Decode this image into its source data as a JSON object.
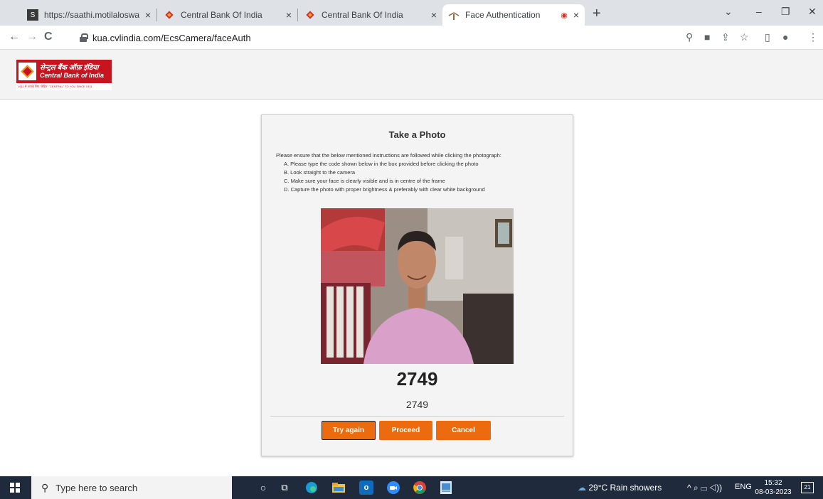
{
  "browser": {
    "tabs": [
      {
        "title": "https://saathi.motilaloswal.com/E",
        "icon": "motilal-icon",
        "active": false
      },
      {
        "title": "Central Bank Of India",
        "icon": "central-bank-icon",
        "active": false
      },
      {
        "title": "Central Bank Of India",
        "icon": "central-bank-icon",
        "active": false
      },
      {
        "title": "Face Authentication",
        "icon": "face-auth-icon",
        "active": true
      }
    ],
    "close_glyph": "×",
    "new_tab_glyph": "+",
    "window_controls": {
      "dropdown": "⌄",
      "minimize": "–",
      "restore": "❐",
      "close": "✕"
    },
    "nav": {
      "back": "←",
      "forward": "→",
      "reload": "C"
    },
    "url": "kua.cvlindia.com/EcsCamera/faceAuth",
    "toolbar_icons": {
      "location": "⚲",
      "camera": "■",
      "share": "⇪",
      "star": "☆",
      "sidepanel": "▯",
      "profile": "●",
      "menu": "⋮"
    }
  },
  "header": {
    "logo_hindi": "सेन्ट्रल बैंक ऑफ़ इंडिया",
    "logo_english": "Central Bank of India",
    "logo_tagline": "1911 से आपके लिए \"केंद्रित\" \"CENTRAL\" TO YOU SINCE 1911"
  },
  "card": {
    "title": "Take a Photo",
    "intro": "Please ensure that the below mentioned instructions are followed while clicking the photograph:",
    "instructions": [
      "A. Please type the code shown below in the box provided before clicking the photo",
      "B. Look straight to the camera",
      "C. Make sure your face is clearly visible and is in centre of the frame",
      "D. Capture the photo with proper brightness & preferably with clear white background"
    ],
    "code_display": "2749",
    "code_input": "2749",
    "buttons": {
      "try_again": "Try again",
      "proceed": "Proceed",
      "cancel": "Cancel"
    },
    "accent_color": "#ec6b0e"
  },
  "taskbar": {
    "search_placeholder": "Type here to search",
    "weather": "29°C  Rain showers",
    "tray_icons": "^ ⌕ ▭ ◁)) ",
    "language": "ENG",
    "time": "15:32",
    "date": "08-03-2023",
    "notification_count": "21"
  }
}
